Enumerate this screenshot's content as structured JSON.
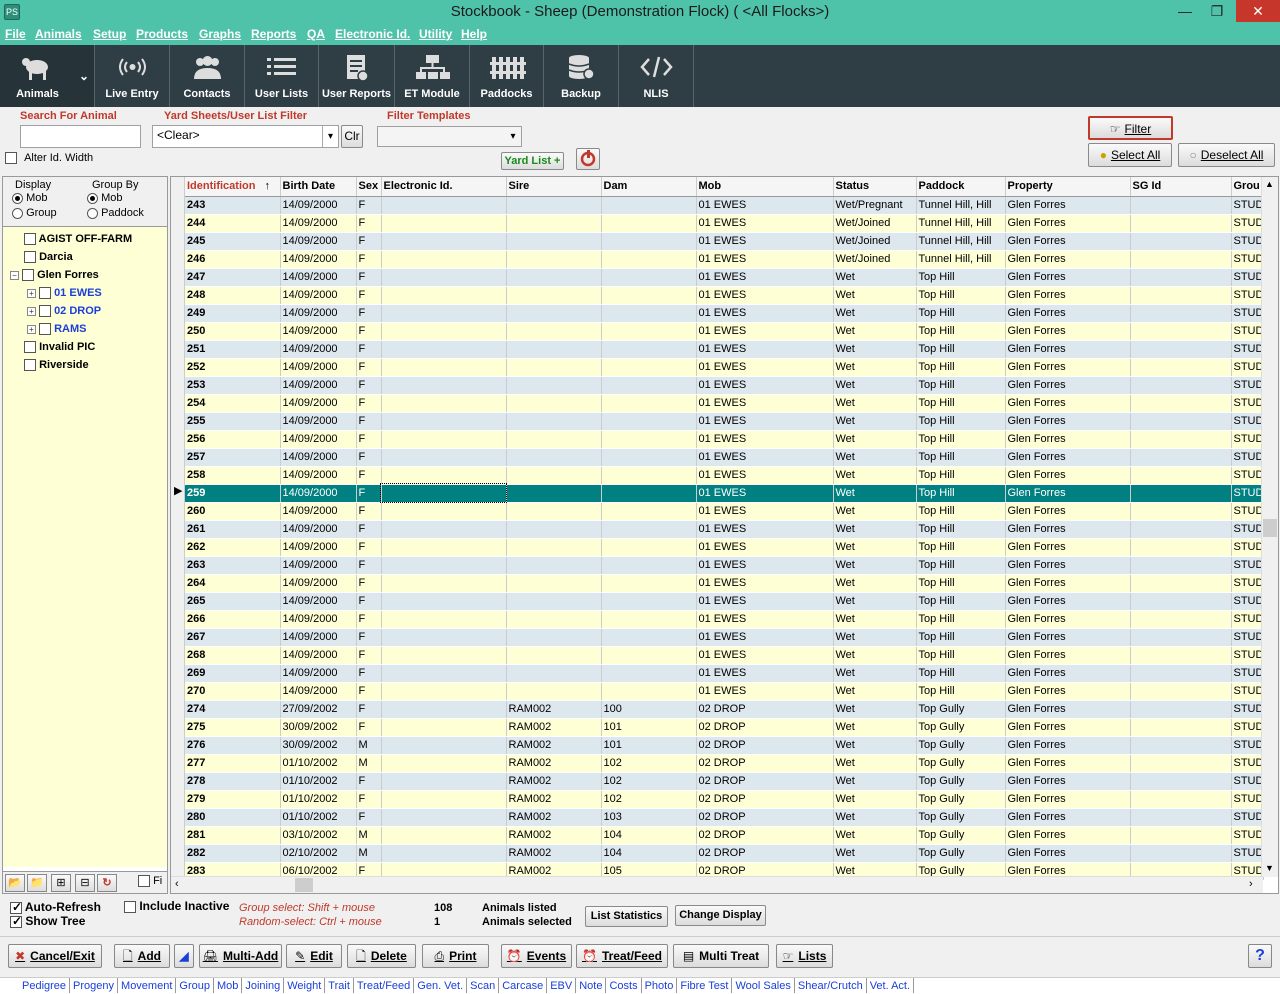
{
  "window": {
    "title": "Stockbook - Sheep (Demonstration Flock) ( <All Flocks>)",
    "minimize": "—",
    "restore": "❐",
    "close": "✕"
  },
  "menu": [
    "File",
    "Animals",
    "Setup",
    "Products",
    "Graphs",
    "Reports",
    "QA",
    "Electronic Id.",
    "Utility",
    "Help"
  ],
  "toolbar": [
    "Animals",
    "Live Entry",
    "Contacts",
    "User Lists",
    "User Reports",
    "ET Module",
    "Paddocks",
    "Backup",
    "NLIS"
  ],
  "filter": {
    "search_label": "Search For Animal",
    "search_value": "",
    "yard_label": "Yard Sheets/User List Filter",
    "yard_value": "<Clear>",
    "clr": "Clr",
    "templates_label": "Filter Templates",
    "templates_value": "",
    "alter_width": "Alter Id. Width",
    "yard_list_btn": "Yard List +",
    "filter_btn": "Filter",
    "select_all": "Select All",
    "deselect_all": "Deselect All"
  },
  "panel": {
    "display_label": "Display",
    "display_options": [
      "Mob",
      "Group"
    ],
    "groupby_label": "Group By",
    "groupby_options": [
      "Mob",
      "Paddock"
    ],
    "fi_label": "Fi"
  },
  "tree": [
    {
      "label": "AGIST OFF-FARM",
      "level": 0,
      "expand": false,
      "blue": false
    },
    {
      "label": "Darcia",
      "level": 0,
      "expand": false,
      "blue": false
    },
    {
      "label": "Glen Forres",
      "level": 0,
      "expand": "minus",
      "blue": false
    },
    {
      "label": "01 EWES",
      "level": 1,
      "expand": "plus",
      "blue": true
    },
    {
      "label": "02 DROP",
      "level": 1,
      "expand": "plus",
      "blue": true
    },
    {
      "label": "RAMS",
      "level": 1,
      "expand": "plus",
      "blue": true
    },
    {
      "label": "Invalid PIC",
      "level": 0,
      "expand": false,
      "blue": false
    },
    {
      "label": "Riverside",
      "level": 0,
      "expand": false,
      "blue": false
    }
  ],
  "grid": {
    "columns": [
      "Identification",
      "Birth Date",
      "Sex",
      "Electronic Id.",
      "Sire",
      "Dam",
      "Mob",
      "Status",
      "Paddock",
      "Property",
      "SG Id",
      "Grou"
    ],
    "sort_icon": "↑",
    "selected_id": "259",
    "rows": [
      [
        "243",
        "14/09/2000",
        "F",
        "",
        "",
        "",
        "01 EWES",
        "Wet/Pregnant",
        "Tunnel Hill, Hill",
        "Glen Forres",
        "",
        "STUD"
      ],
      [
        "244",
        "14/09/2000",
        "F",
        "",
        "",
        "",
        "01 EWES",
        "Wet/Joined",
        "Tunnel Hill, Hill",
        "Glen Forres",
        "",
        "STUD"
      ],
      [
        "245",
        "14/09/2000",
        "F",
        "",
        "",
        "",
        "01 EWES",
        "Wet/Joined",
        "Tunnel Hill, Hill",
        "Glen Forres",
        "",
        "STUD"
      ],
      [
        "246",
        "14/09/2000",
        "F",
        "",
        "",
        "",
        "01 EWES",
        "Wet/Joined",
        "Tunnel Hill, Hill",
        "Glen Forres",
        "",
        "STUD"
      ],
      [
        "247",
        "14/09/2000",
        "F",
        "",
        "",
        "",
        "01 EWES",
        "Wet",
        "Top Hill",
        "Glen Forres",
        "",
        "STUD"
      ],
      [
        "248",
        "14/09/2000",
        "F",
        "",
        "",
        "",
        "01 EWES",
        "Wet",
        "Top Hill",
        "Glen Forres",
        "",
        "STUD"
      ],
      [
        "249",
        "14/09/2000",
        "F",
        "",
        "",
        "",
        "01 EWES",
        "Wet",
        "Top Hill",
        "Glen Forres",
        "",
        "STUD"
      ],
      [
        "250",
        "14/09/2000",
        "F",
        "",
        "",
        "",
        "01 EWES",
        "Wet",
        "Top Hill",
        "Glen Forres",
        "",
        "STUD"
      ],
      [
        "251",
        "14/09/2000",
        "F",
        "",
        "",
        "",
        "01 EWES",
        "Wet",
        "Top Hill",
        "Glen Forres",
        "",
        "STUD"
      ],
      [
        "252",
        "14/09/2000",
        "F",
        "",
        "",
        "",
        "01 EWES",
        "Wet",
        "Top Hill",
        "Glen Forres",
        "",
        "STUD"
      ],
      [
        "253",
        "14/09/2000",
        "F",
        "",
        "",
        "",
        "01 EWES",
        "Wet",
        "Top Hill",
        "Glen Forres",
        "",
        "STUD"
      ],
      [
        "254",
        "14/09/2000",
        "F",
        "",
        "",
        "",
        "01 EWES",
        "Wet",
        "Top Hill",
        "Glen Forres",
        "",
        "STUD"
      ],
      [
        "255",
        "14/09/2000",
        "F",
        "",
        "",
        "",
        "01 EWES",
        "Wet",
        "Top Hill",
        "Glen Forres",
        "",
        "STUD"
      ],
      [
        "256",
        "14/09/2000",
        "F",
        "",
        "",
        "",
        "01 EWES",
        "Wet",
        "Top Hill",
        "Glen Forres",
        "",
        "STUD"
      ],
      [
        "257",
        "14/09/2000",
        "F",
        "",
        "",
        "",
        "01 EWES",
        "Wet",
        "Top Hill",
        "Glen Forres",
        "",
        "STUD"
      ],
      [
        "258",
        "14/09/2000",
        "F",
        "",
        "",
        "",
        "01 EWES",
        "Wet",
        "Top Hill",
        "Glen Forres",
        "",
        "STUD"
      ],
      [
        "259",
        "14/09/2000",
        "F",
        "",
        "",
        "",
        "01 EWES",
        "Wet",
        "Top Hill",
        "Glen Forres",
        "",
        "STUD"
      ],
      [
        "260",
        "14/09/2000",
        "F",
        "",
        "",
        "",
        "01 EWES",
        "Wet",
        "Top Hill",
        "Glen Forres",
        "",
        "STUD"
      ],
      [
        "261",
        "14/09/2000",
        "F",
        "",
        "",
        "",
        "01 EWES",
        "Wet",
        "Top Hill",
        "Glen Forres",
        "",
        "STUD"
      ],
      [
        "262",
        "14/09/2000",
        "F",
        "",
        "",
        "",
        "01 EWES",
        "Wet",
        "Top Hill",
        "Glen Forres",
        "",
        "STUD"
      ],
      [
        "263",
        "14/09/2000",
        "F",
        "",
        "",
        "",
        "01 EWES",
        "Wet",
        "Top Hill",
        "Glen Forres",
        "",
        "STUD"
      ],
      [
        "264",
        "14/09/2000",
        "F",
        "",
        "",
        "",
        "01 EWES",
        "Wet",
        "Top Hill",
        "Glen Forres",
        "",
        "STUD"
      ],
      [
        "265",
        "14/09/2000",
        "F",
        "",
        "",
        "",
        "01 EWES",
        "Wet",
        "Top Hill",
        "Glen Forres",
        "",
        "STUD"
      ],
      [
        "266",
        "14/09/2000",
        "F",
        "",
        "",
        "",
        "01 EWES",
        "Wet",
        "Top Hill",
        "Glen Forres",
        "",
        "STUD"
      ],
      [
        "267",
        "14/09/2000",
        "F",
        "",
        "",
        "",
        "01 EWES",
        "Wet",
        "Top Hill",
        "Glen Forres",
        "",
        "STUD"
      ],
      [
        "268",
        "14/09/2000",
        "F",
        "",
        "",
        "",
        "01 EWES",
        "Wet",
        "Top Hill",
        "Glen Forres",
        "",
        "STUD"
      ],
      [
        "269",
        "14/09/2000",
        "F",
        "",
        "",
        "",
        "01 EWES",
        "Wet",
        "Top Hill",
        "Glen Forres",
        "",
        "STUD"
      ],
      [
        "270",
        "14/09/2000",
        "F",
        "",
        "",
        "",
        "01 EWES",
        "Wet",
        "Top Hill",
        "Glen Forres",
        "",
        "STUD"
      ],
      [
        "274",
        "27/09/2002",
        "F",
        "",
        "RAM002",
        "100",
        "02 DROP",
        "Wet",
        "Top Gully",
        "Glen Forres",
        "",
        "STUD"
      ],
      [
        "275",
        "30/09/2002",
        "F",
        "",
        "RAM002",
        "101",
        "02 DROP",
        "Wet",
        "Top Gully",
        "Glen Forres",
        "",
        "STUD"
      ],
      [
        "276",
        "30/09/2002",
        "M",
        "",
        "RAM002",
        "101",
        "02 DROP",
        "Wet",
        "Top Gully",
        "Glen Forres",
        "",
        "STUD"
      ],
      [
        "277",
        "01/10/2002",
        "M",
        "",
        "RAM002",
        "102",
        "02 DROP",
        "Wet",
        "Top Gully",
        "Glen Forres",
        "",
        "STUD"
      ],
      [
        "278",
        "01/10/2002",
        "F",
        "",
        "RAM002",
        "102",
        "02 DROP",
        "Wet",
        "Top Gully",
        "Glen Forres",
        "",
        "STUD"
      ],
      [
        "279",
        "01/10/2002",
        "F",
        "",
        "RAM002",
        "102",
        "02 DROP",
        "Wet",
        "Top Gully",
        "Glen Forres",
        "",
        "STUD"
      ],
      [
        "280",
        "01/10/2002",
        "F",
        "",
        "RAM002",
        "103",
        "02 DROP",
        "Wet",
        "Top Gully",
        "Glen Forres",
        "",
        "STUD"
      ],
      [
        "281",
        "03/10/2002",
        "M",
        "",
        "RAM002",
        "104",
        "02 DROP",
        "Wet",
        "Top Gully",
        "Glen Forres",
        "",
        "STUD"
      ],
      [
        "282",
        "02/10/2002",
        "M",
        "",
        "RAM002",
        "104",
        "02 DROP",
        "Wet",
        "Top Gully",
        "Glen Forres",
        "",
        "STUD"
      ],
      [
        "283",
        "06/10/2002",
        "F",
        "",
        "RAM002",
        "105",
        "02 DROP",
        "Wet",
        "Top Gully",
        "Glen Forres",
        "",
        "STUD"
      ]
    ]
  },
  "status": {
    "auto_refresh": "Auto-Refresh",
    "show_tree": "Show Tree",
    "include_inactive": "Include Inactive",
    "group_select": "Group select: Shift + mouse",
    "random_select": "Random-select: Ctrl + mouse",
    "listed_count": "108",
    "listed_label": "Animals listed",
    "selected_count": "1",
    "selected_label": "Animals selected",
    "list_stats": "List Statistics",
    "change_display": "Change Display"
  },
  "actions": [
    "Cancel/Exit",
    "Add",
    "Multi-Add",
    "Edit",
    "Delete",
    "Print",
    "Events",
    "Treat/Feed",
    "Multi Treat",
    "Lists"
  ],
  "help": "?",
  "links": [
    "Pedigree",
    "Progeny",
    "Movement",
    "Group",
    "Mob",
    "Joining",
    "Weight",
    "Trait",
    "Treat/Feed",
    "Gen. Vet.",
    "Scan",
    "Carcase",
    "EBV",
    "Note",
    "Costs",
    "Photo",
    "Fibre Test",
    "Wool Sales",
    "Shear/Crutch",
    "Vet. Act."
  ]
}
